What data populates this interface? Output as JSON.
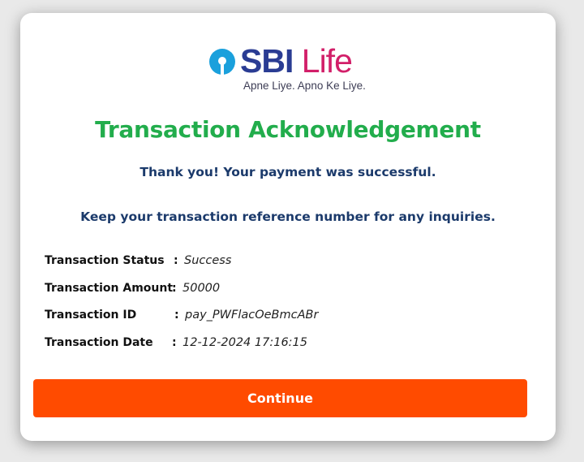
{
  "brand": {
    "name_part1": "SBI",
    "name_part2": "Life",
    "tagline": "Apne Liye. Apno Ke Liye.",
    "icon": "sbi-keyhole-icon"
  },
  "page": {
    "title": "Transaction Acknowledgement",
    "message_success": "Thank you! Your payment was successful.",
    "message_reference": "Keep your transaction reference number for any inquiries."
  },
  "details": [
    {
      "label": "Transaction Status",
      "colon": ":",
      "value": "Success"
    },
    {
      "label": "Transaction Amount",
      "colon": ":",
      "value": "50000"
    },
    {
      "label": "Transaction ID",
      "colon": ":",
      "value": "pay_PWFlacOeBmcABr"
    },
    {
      "label": "Transaction Date",
      "colon": ":",
      "value": "12-12-2024 17:16:15"
    }
  ],
  "actions": {
    "continue_label": "Continue"
  },
  "colors": {
    "title_green": "#22ad4c",
    "message_navy": "#1b3a6b",
    "button_orange": "#ff4b00",
    "brand_blue": "#2a3c93",
    "brand_pink": "#d21f69"
  }
}
